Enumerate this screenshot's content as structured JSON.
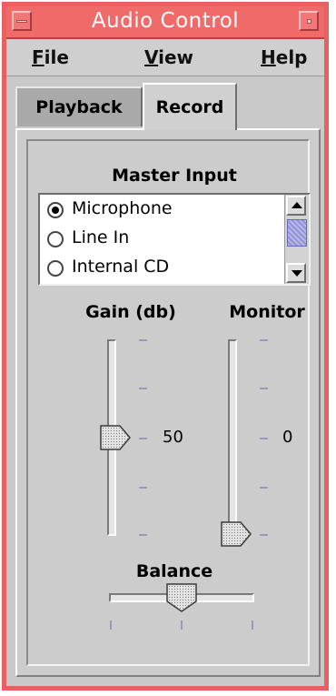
{
  "window": {
    "title": "Audio Control",
    "frame_color": "#e86060",
    "titlebar_color": "#f06a6a"
  },
  "menu": {
    "file_mnemonic": "F",
    "file_rest": "ile",
    "view_mnemonic": "V",
    "view_rest": "iew",
    "help_mnemonic": "H",
    "help_rest": "elp"
  },
  "tabs": [
    {
      "label": "Playback",
      "selected": false
    },
    {
      "label": "Record",
      "selected": true
    }
  ],
  "master_input": {
    "heading": "Master Input",
    "options": [
      {
        "label": "Microphone",
        "selected": true
      },
      {
        "label": "Line In",
        "selected": false
      },
      {
        "label": "Internal CD",
        "selected": false
      }
    ]
  },
  "gain": {
    "label": "Gain (db)",
    "value_text": "50",
    "level": 0.5
  },
  "monitor": {
    "label": "Monitor",
    "value_text": "0",
    "level": 0.0
  },
  "balance": {
    "label": "Balance",
    "level": 0.5
  }
}
